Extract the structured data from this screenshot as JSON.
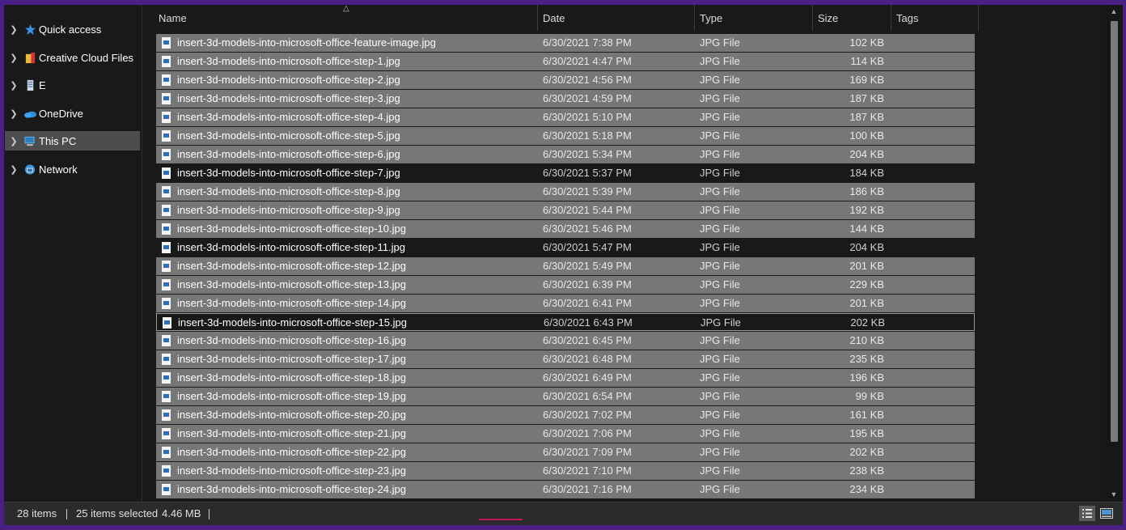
{
  "nav": {
    "items": [
      {
        "label": "Quick access",
        "icon": "star-icon"
      },
      {
        "label": "Creative Cloud Files",
        "icon": "creative-cloud-icon"
      },
      {
        "label": "E",
        "icon": "drive-icon"
      },
      {
        "label": "OneDrive",
        "icon": "cloud-icon"
      },
      {
        "label": "This PC",
        "icon": "computer-icon",
        "selected": true
      },
      {
        "label": "Network",
        "icon": "network-icon"
      }
    ]
  },
  "columns": {
    "name": "Name",
    "date": "Date",
    "type": "Type",
    "size": "Size",
    "tags": "Tags"
  },
  "files": [
    {
      "name": "insert-3d-models-into-microsoft-office-feature-image.jpg",
      "date": "6/30/2021 7:38 PM",
      "type": "JPG File",
      "size": "102 KB",
      "selected": true
    },
    {
      "name": "insert-3d-models-into-microsoft-office-step-1.jpg",
      "date": "6/30/2021 4:47 PM",
      "type": "JPG File",
      "size": "114 KB",
      "selected": true
    },
    {
      "name": "insert-3d-models-into-microsoft-office-step-2.jpg",
      "date": "6/30/2021 4:56 PM",
      "type": "JPG File",
      "size": "169 KB",
      "selected": true
    },
    {
      "name": "insert-3d-models-into-microsoft-office-step-3.jpg",
      "date": "6/30/2021 4:59 PM",
      "type": "JPG File",
      "size": "187 KB",
      "selected": true
    },
    {
      "name": "insert-3d-models-into-microsoft-office-step-4.jpg",
      "date": "6/30/2021 5:10 PM",
      "type": "JPG File",
      "size": "187 KB",
      "selected": true
    },
    {
      "name": "insert-3d-models-into-microsoft-office-step-5.jpg",
      "date": "6/30/2021 5:18 PM",
      "type": "JPG File",
      "size": "100 KB",
      "selected": true
    },
    {
      "name": "insert-3d-models-into-microsoft-office-step-6.jpg",
      "date": "6/30/2021 5:34 PM",
      "type": "JPG File",
      "size": "204 KB",
      "selected": true
    },
    {
      "name": "insert-3d-models-into-microsoft-office-step-7.jpg",
      "date": "6/30/2021 5:37 PM",
      "type": "JPG File",
      "size": "184 KB",
      "selected": false
    },
    {
      "name": "insert-3d-models-into-microsoft-office-step-8.jpg",
      "date": "6/30/2021 5:39 PM",
      "type": "JPG File",
      "size": "186 KB",
      "selected": true
    },
    {
      "name": "insert-3d-models-into-microsoft-office-step-9.jpg",
      "date": "6/30/2021 5:44 PM",
      "type": "JPG File",
      "size": "192 KB",
      "selected": true
    },
    {
      "name": "insert-3d-models-into-microsoft-office-step-10.jpg",
      "date": "6/30/2021 5:46 PM",
      "type": "JPG File",
      "size": "144 KB",
      "selected": true
    },
    {
      "name": "insert-3d-models-into-microsoft-office-step-11.jpg",
      "date": "6/30/2021 5:47 PM",
      "type": "JPG File",
      "size": "204 KB",
      "selected": false
    },
    {
      "name": "insert-3d-models-into-microsoft-office-step-12.jpg",
      "date": "6/30/2021 5:49 PM",
      "type": "JPG File",
      "size": "201 KB",
      "selected": true
    },
    {
      "name": "insert-3d-models-into-microsoft-office-step-13.jpg",
      "date": "6/30/2021 6:39 PM",
      "type": "JPG File",
      "size": "229 KB",
      "selected": true
    },
    {
      "name": "insert-3d-models-into-microsoft-office-step-14.jpg",
      "date": "6/30/2021 6:41 PM",
      "type": "JPG File",
      "size": "201 KB",
      "selected": true
    },
    {
      "name": "insert-3d-models-into-microsoft-office-step-15.jpg",
      "date": "6/30/2021 6:43 PM",
      "type": "JPG File",
      "size": "202 KB",
      "selected": false,
      "focused": true
    },
    {
      "name": "insert-3d-models-into-microsoft-office-step-16.jpg",
      "date": "6/30/2021 6:45 PM",
      "type": "JPG File",
      "size": "210 KB",
      "selected": true
    },
    {
      "name": "insert-3d-models-into-microsoft-office-step-17.jpg",
      "date": "6/30/2021 6:48 PM",
      "type": "JPG File",
      "size": "235 KB",
      "selected": true
    },
    {
      "name": "insert-3d-models-into-microsoft-office-step-18.jpg",
      "date": "6/30/2021 6:49 PM",
      "type": "JPG File",
      "size": "196 KB",
      "selected": true
    },
    {
      "name": "insert-3d-models-into-microsoft-office-step-19.jpg",
      "date": "6/30/2021 6:54 PM",
      "type": "JPG File",
      "size": "99 KB",
      "selected": true
    },
    {
      "name": "insert-3d-models-into-microsoft-office-step-20.jpg",
      "date": "6/30/2021 7:02 PM",
      "type": "JPG File",
      "size": "161 KB",
      "selected": true
    },
    {
      "name": "insert-3d-models-into-microsoft-office-step-21.jpg",
      "date": "6/30/2021 7:06 PM",
      "type": "JPG File",
      "size": "195 KB",
      "selected": true
    },
    {
      "name": "insert-3d-models-into-microsoft-office-step-22.jpg",
      "date": "6/30/2021 7:09 PM",
      "type": "JPG File",
      "size": "202 KB",
      "selected": true
    },
    {
      "name": "insert-3d-models-into-microsoft-office-step-23.jpg",
      "date": "6/30/2021 7:10 PM",
      "type": "JPG File",
      "size": "238 KB",
      "selected": true
    },
    {
      "name": "insert-3d-models-into-microsoft-office-step-24.jpg",
      "date": "6/30/2021 7:16 PM",
      "type": "JPG File",
      "size": "234 KB",
      "selected": true
    }
  ],
  "status": {
    "item_count": "28 items",
    "selected": "25 items selected",
    "selected_size": "4.46 MB"
  },
  "colors": {
    "selection": "#777777",
    "background": "#191919",
    "frame": "#4a1f86",
    "accent": "#c2185b"
  }
}
